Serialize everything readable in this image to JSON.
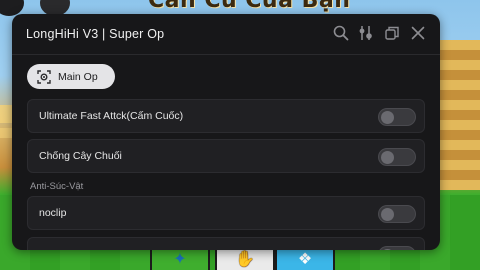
{
  "background": {
    "sign_text": "Cần Cù Của Bạn",
    "sign_subtext": "",
    "colors": {
      "sky": "#8ec5ec",
      "grass": "#3aa82b",
      "sand": "#d9b56a"
    }
  },
  "window": {
    "title": "LongHiHi V3 | Super Op",
    "icons": [
      "search-icon",
      "tools-icon",
      "restore-icon",
      "close-icon"
    ]
  },
  "tabs": [
    {
      "label": "Main Op",
      "icon": "target-icon",
      "selected": true
    }
  ],
  "rows": [
    {
      "label": "Ultimate Fast Attck(Cấm Cuốc)",
      "on": false
    },
    {
      "label": "Chống Cây Chuối",
      "on": false
    }
  ],
  "sections": [
    {
      "label": "Anti-Súc-Vật",
      "rows": [
        {
          "label": "noclip",
          "on": false
        }
      ]
    }
  ],
  "colors": {
    "window_bg": "#171719",
    "row_bg": "#202023",
    "tab_bg": "#e4e4e7",
    "toggle_off": "#3a3a3e"
  }
}
